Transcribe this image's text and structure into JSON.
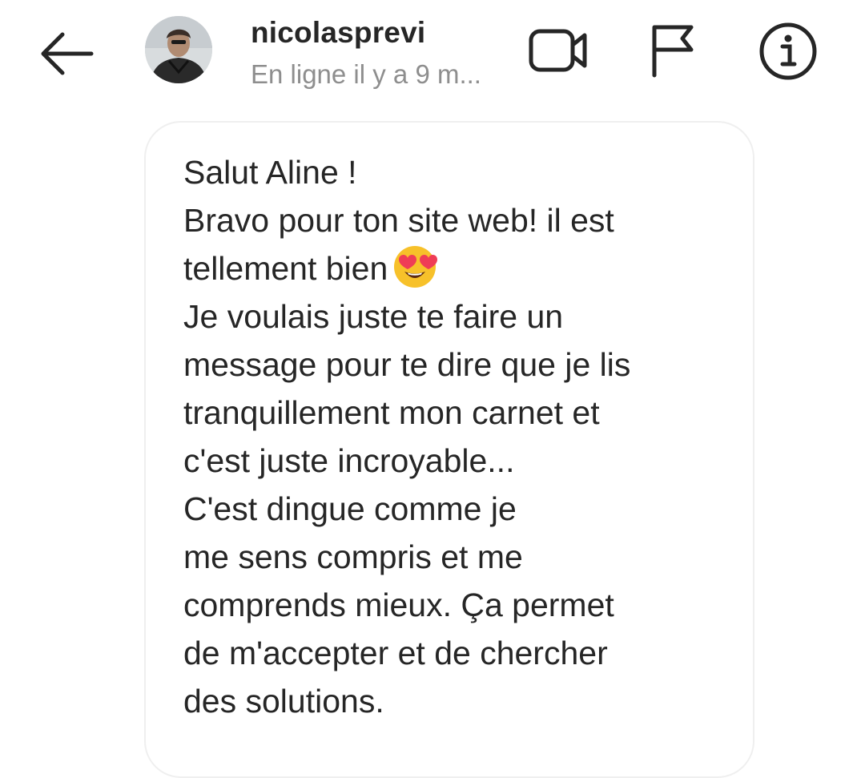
{
  "header": {
    "back_icon": "arrow-left-icon",
    "avatar_icon": "profile-photo",
    "username": "nicolasprevi",
    "status": "En ligne il y a 9 m...",
    "video_icon": "video-call-icon",
    "flag_icon": "flag-icon",
    "info_icon": "info-icon"
  },
  "message": {
    "lines": [
      "Salut Aline !",
      "Bravo pour ton site web! il est",
      "tellement bien",
      "Je voulais juste te faire un",
      "message pour te dire que je lis",
      "tranquillement mon carnet et",
      "c'est juste incroyable...",
      "C'est dingue comme je",
      "me sens compris et me",
      "comprends mieux. Ça permet",
      "de m'accepter et de chercher",
      "des solutions."
    ],
    "emoji": "heart-eyes-emoji"
  },
  "colors": {
    "text": "#262626",
    "secondary": "#8e8e8e",
    "bubble_border": "#efefef",
    "emoji_face": "#f7c12a",
    "emoji_heart": "#ef3d56"
  }
}
